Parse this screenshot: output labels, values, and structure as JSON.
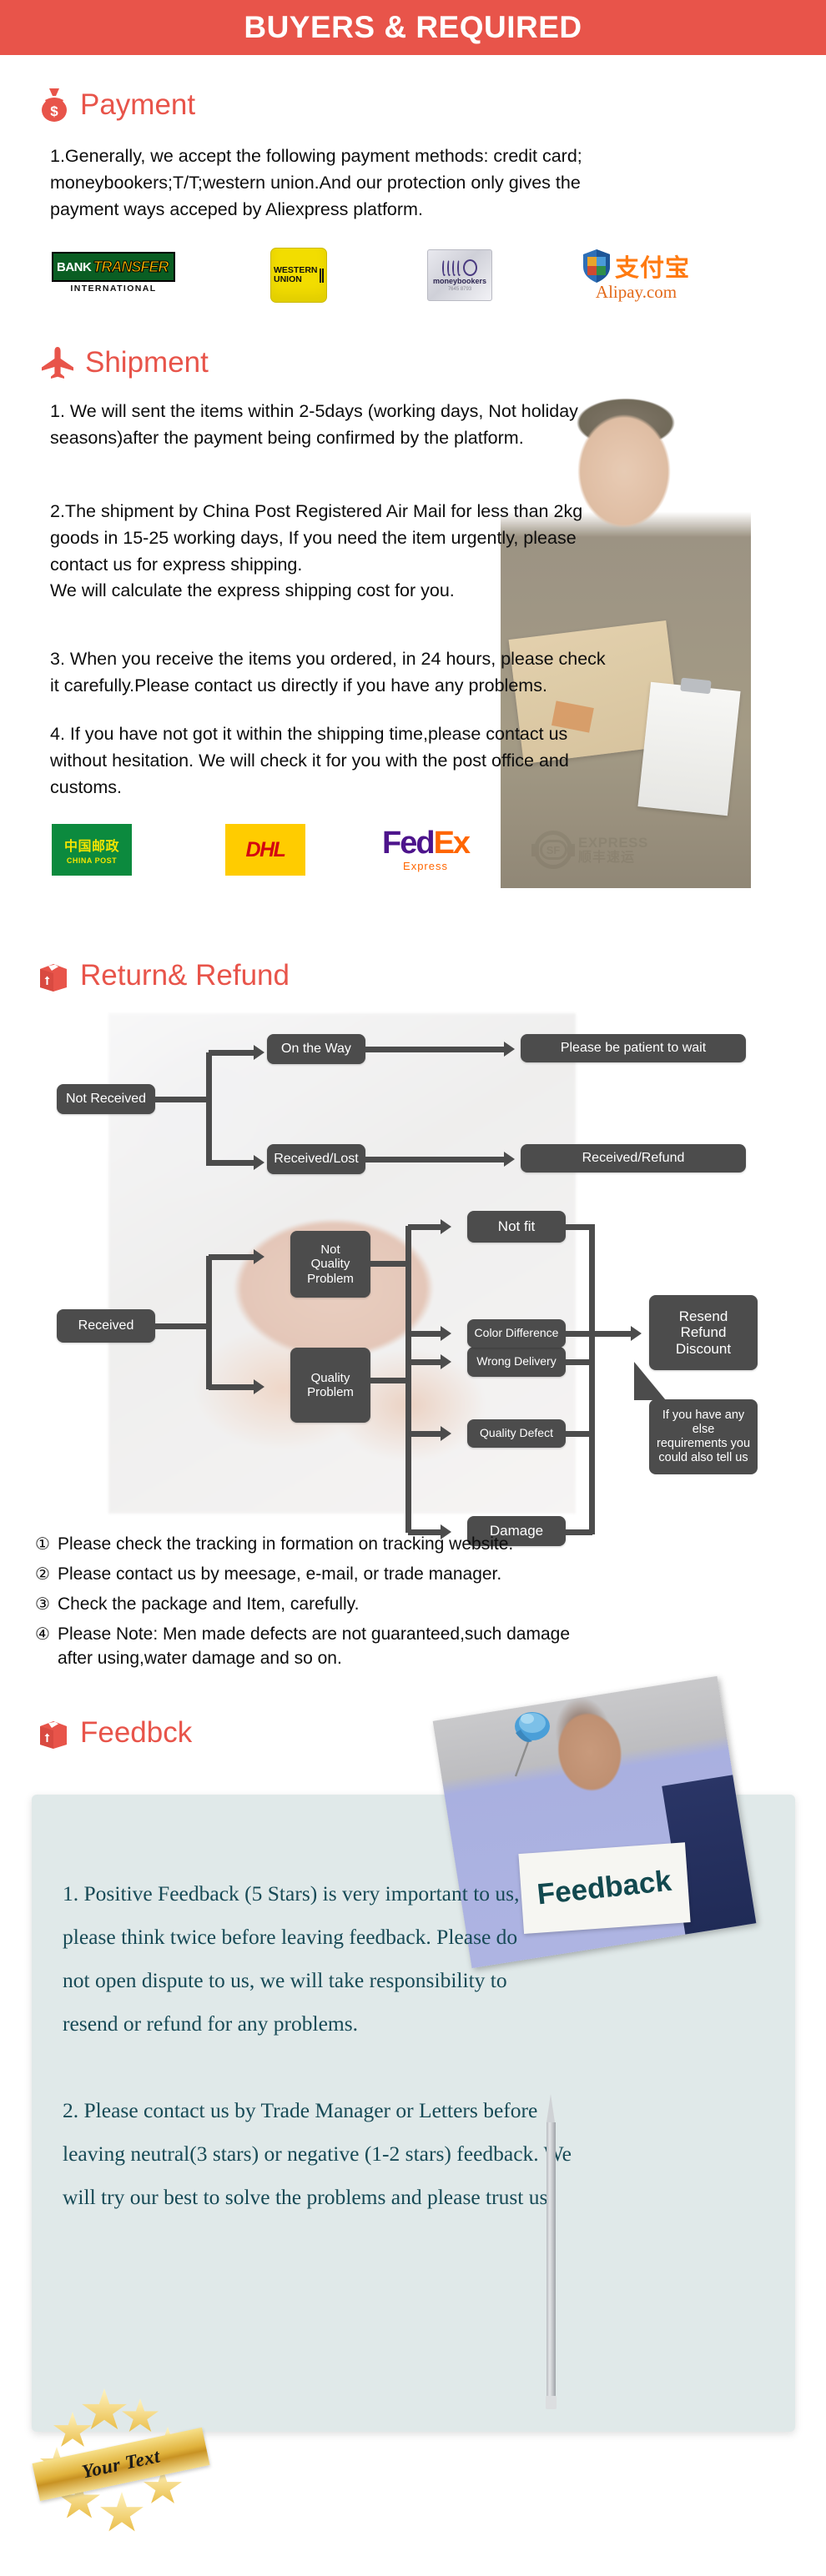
{
  "banner": {
    "title": "BUYERS & REQUIRED"
  },
  "sections": {
    "payment": {
      "heading": "Payment",
      "icon": "money-bag-icon",
      "body": "1.Generally, we accept the following payment methods: credit card;\nmoneybookers;T/T;western union.And our protection only gives the\npayment ways acceped by Aliexpress platform.",
      "logos": [
        {
          "name": "bank-transfer",
          "line1": "BANK",
          "line2": "TRANSFER",
          "line3": "INTERNATIONAL"
        },
        {
          "name": "western-union",
          "line1": "WESTERN",
          "line2": "UNION"
        },
        {
          "name": "moneybookers",
          "line1": "moneybookers",
          "line2": "7645 8793"
        },
        {
          "name": "alipay",
          "line1": "支付宝",
          "line2": "Alipay.com"
        }
      ]
    },
    "shipment": {
      "heading": "Shipment",
      "icon": "airplane-icon",
      "body1": "1. We will sent the items within 2-5days (working days, Not holiday\nseasons)after the payment being confirmed by the platform.",
      "body2": "2.The shipment by China Post Registered Air Mail for less than  2kg\ngoods in 15-25 working days, If  you need the item urgently, please\ncontact us for express shipping.\nWe will calculate the express shipping cost for you.",
      "body3": "3. When you receive the items you ordered, in 24 hours, please check\n it carefully.Please contact us directly if you have any problems.",
      "body4": "4. If you have not got it within the shipping time,please contact us\nwithout hesitation. We will check it for you with the post office and\ncustoms.",
      "carriers": [
        {
          "name": "china-post",
          "cn": "中国邮政",
          "en": "CHINA POST"
        },
        {
          "name": "dhl",
          "text": "DHL"
        },
        {
          "name": "fedex",
          "fed": "Fed",
          "ex": "Ex",
          "sub": "Express"
        },
        {
          "name": "sf-express",
          "mark": "SF",
          "en": "EXPRESS",
          "cn": "顺丰速运"
        }
      ]
    },
    "return_refund": {
      "heading": "Return& Refund",
      "icon": "package-box-icon",
      "flow_top": {
        "source": "Not Received",
        "branches": [
          {
            "mid": "On the Way",
            "end": "Please be patient to wait"
          },
          {
            "mid": "Received/Lost",
            "end": "Received/Refund"
          }
        ]
      },
      "flow_bottom": {
        "source": "Received",
        "group_a": {
          "label": "Not\nQuality\nProblem",
          "items": [
            "Not fit",
            "Wrong Delivery"
          ]
        },
        "group_b": {
          "label": "Quality\nProblem",
          "items": [
            "Color Difference",
            "Quality Defect",
            "Damage"
          ]
        },
        "outcome": "Resend\nRefund\nDiscount",
        "callout": "If you have any else\nrequirements you\ncould also tell us"
      },
      "notes": [
        {
          "num": "①",
          "text": "Please check the tracking in formation on tracking website."
        },
        {
          "num": "②",
          "text": "Please contact us by meesage, e-mail, or trade manager."
        },
        {
          "num": "③",
          "text": "Check the package and Item, carefully."
        },
        {
          "num": "④",
          "text": "Please Note: Men made defects  are not guaranteed,such damage\n    after using,water damage and so on."
        }
      ]
    },
    "feedback": {
      "heading": "Feedbck",
      "icon": "package-box-icon",
      "photo_sign": "Feedback",
      "body": "1. Positive Feedback (5 Stars) is very important to us,\nplease think twice before leaving feedback. Please do\nnot open dispute to us,   we will take responsibility to\nresend or refund for any problems.\n\n2. Please contact us by Trade Manager or Letters before\nleaving neutral(3 stars) or negative (1-2 stars) feedback. We\nwill try our best to solve the problems and please trust us",
      "badge_text": "Your Text"
    }
  },
  "colors": {
    "accent_red": "#e8544a",
    "flow_node": "#4c4c4c",
    "feedback_panel": "#e0e9e9",
    "feedback_text": "#174a56"
  }
}
